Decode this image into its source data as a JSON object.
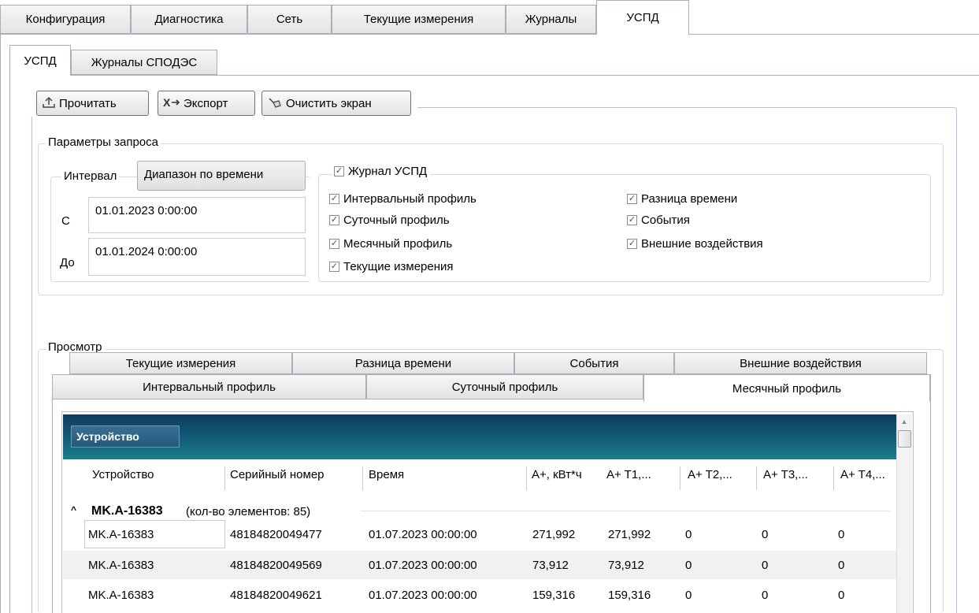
{
  "main_tabs": [
    "Конфигурация",
    "Диагностика",
    "Сеть",
    "Текущие измерения",
    "Журналы",
    "УСПД"
  ],
  "sub_tabs": [
    "УСПД",
    "Журналы СПОДЭС"
  ],
  "toolbar": {
    "read_label": "Прочитать",
    "export_label": "Экспорт",
    "clear_label": "Очистить экран"
  },
  "query": {
    "legend": "Параметры запроса",
    "interval_label": "Интервал",
    "interval_value": "Диапазон по времени",
    "from_label": "С",
    "from_value": "01.01.2023 0:00:00",
    "to_label": "До",
    "to_value": "01.01.2024 0:00:00",
    "journal_label": "Журнал УСПД",
    "checkboxes_col1": [
      "Интервальный профиль",
      "Суточный профиль",
      "Месячный профиль",
      "Текущие измерения"
    ],
    "checkboxes_col2": [
      "Разница времени",
      "События",
      "Внешние воздействия"
    ]
  },
  "view": {
    "legend": "Просмотр",
    "tabs_row1": [
      "Текущие измерения",
      "Разница времени",
      "События",
      "Внешние воздействия"
    ],
    "tabs_row2": [
      "Интервальный профиль",
      "Суточный профиль",
      "Месячный профиль"
    ],
    "grid_group_label": "Устройство",
    "columns": [
      "Устройство",
      "Серийный номер",
      "Время",
      "A+, кВт*ч",
      "A+ T1,...",
      "A+ T2,...",
      "A+ T3,...",
      "A+ T4,..."
    ],
    "group_name": "MK.A-16383",
    "group_count": "(кол-во элементов: 85)",
    "rows": [
      [
        "MK.A-16383",
        "48184820049477",
        "01.07.2023 00:00:00",
        "271,992",
        "271,992",
        "0",
        "0",
        "0"
      ],
      [
        "MK.A-16383",
        "48184820049569",
        "01.07.2023 00:00:00",
        "73,912",
        "73,912",
        "0",
        "0",
        "0"
      ],
      [
        "MK.A-16383",
        "48184820049621",
        "01.07.2023 00:00:00",
        "159,316",
        "159,316",
        "0",
        "0",
        "0"
      ]
    ]
  },
  "icons": {
    "read": "upload-icon",
    "export": "export-icon",
    "clear": "eraser-icon",
    "collapse": "chevron-up-icon",
    "check": "checkmark-icon"
  }
}
